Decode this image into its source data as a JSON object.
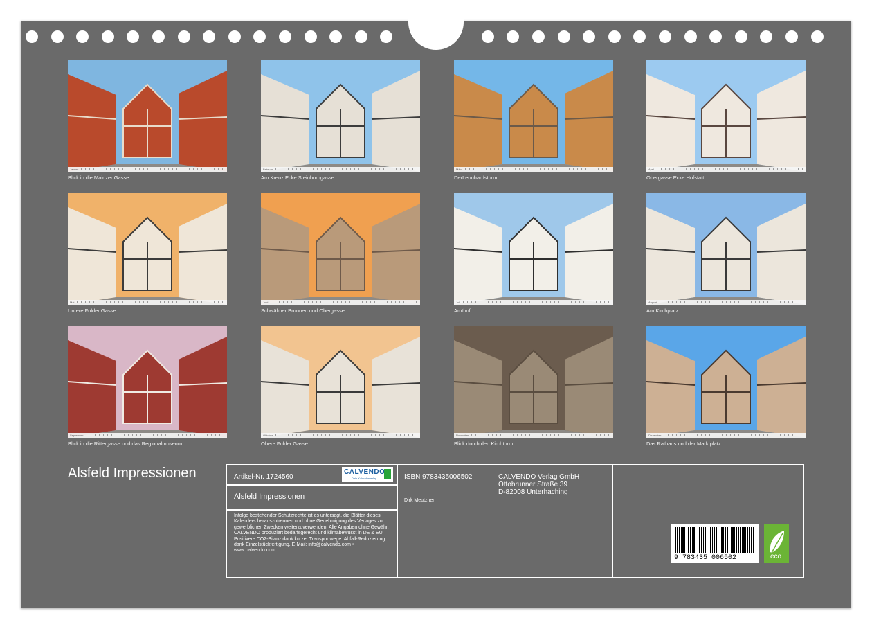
{
  "calendar_title": "Alsfeld Impressionen",
  "photos": [
    {
      "caption": "Blick in die Mainzer Gasse",
      "month": "Januar"
    },
    {
      "caption": "Am Kreuz Ecke Steinborngasse",
      "month": "Februar"
    },
    {
      "caption": "DerLeonhardsturm",
      "month": "März"
    },
    {
      "caption": "Obergasse Ecke Hofstatt",
      "month": "April"
    },
    {
      "caption": "Untere Fulder Gasse",
      "month": "Mai"
    },
    {
      "caption": "Schwälmer Brunnen und Obergasse",
      "month": "Juni"
    },
    {
      "caption": "Amthof",
      "month": "Juli"
    },
    {
      "caption": "Am Kirchplatz",
      "month": "August"
    },
    {
      "caption": "Blick in die Rittergasse und das Regionalmuseum",
      "month": "September"
    },
    {
      "caption": "Obere Fulder Gasse",
      "month": "Oktober"
    },
    {
      "caption": "Blick durch den Kirchturm",
      "month": "November"
    },
    {
      "caption": "Das Rathaus und der Marktplatz",
      "month": "Dezember"
    }
  ],
  "info": {
    "article": "Artikel-Nr. 1724560",
    "logo_text": "CALVENDO",
    "logo_sub": "Dein Kalenderverlag",
    "title": "Alsfeld Impressionen",
    "legal": "Infolge bestehender Schutzrechte ist es untersagt, die Blätter dieses Kalenders herauszutrennen und ohne Genehmigung des Verlages zu gewerblichen Zwecken weiterzuverwenden. Alle Angaben ohne Gewähr. CALVENDO produziert bedarfsgerecht und klimabewusst in DE & EU. Positivere CO2-Bilanz dank kurzer Transportwege. Abfall-Reduzierung dank Einzelstückfertigung. E-Mail: info@calvendo.com • www.calvendo.com",
    "isbn": "ISBN 9783435006502",
    "author": "Dirk Meutzner",
    "publisher_name": "CALVENDO Verlag GmbH",
    "publisher_street": "Ottobrunner Straße 39",
    "publisher_city": "D-82008 Unterhaching",
    "barcode_number": "9 783435 006502",
    "eco_label": "eco"
  },
  "colors": {
    "page_bg": "#6a6a6a",
    "line": "#ffffff"
  }
}
